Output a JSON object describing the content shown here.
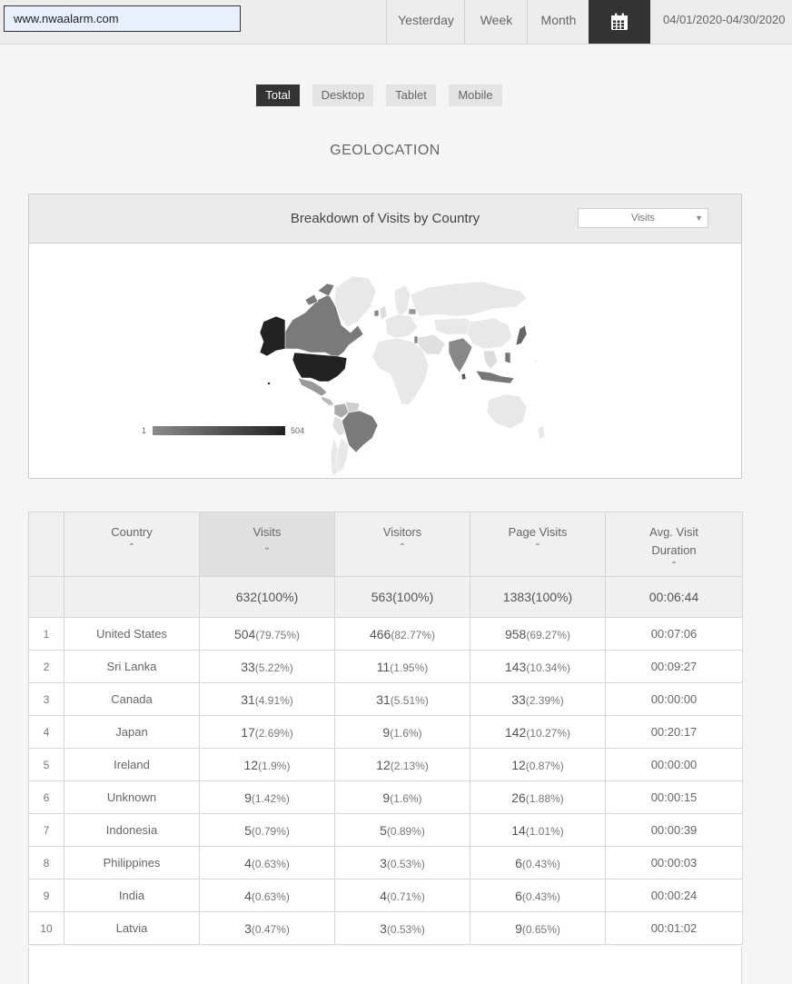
{
  "topbar": {
    "site": "www.nwaalarm.com",
    "periods": [
      "Yesterday",
      "Week",
      "Month"
    ],
    "calendar_icon": "calendar-icon",
    "date_range": "04/01/2020-04/30/2020"
  },
  "device_tabs": [
    "Total",
    "Desktop",
    "Tablet",
    "Mobile"
  ],
  "active_tab": "Total",
  "section_title": "GEOLOCATION",
  "map": {
    "title": "Breakdown of Visits by Country",
    "metric_selected": "Visits",
    "legend_min": "1",
    "legend_max": "504",
    "colors": {
      "low": "#8a8a8a",
      "high": "#222222",
      "none": "#e8e8e8"
    }
  },
  "table": {
    "headers": {
      "country": "Country",
      "visits": "Visits",
      "visitors": "Visitors",
      "page_visits": "Page Visits",
      "avg_duration": "Avg. Visit Duration"
    },
    "sorted_column": "visits",
    "sort_arrows": {
      "up": "⌃",
      "down": "⌄"
    },
    "totals": {
      "visits": "632(100%)",
      "visitors": "563(100%)",
      "page_visits": "1383(100%)",
      "avg_duration": "00:06:44"
    },
    "rows": [
      {
        "rank": "1",
        "country": "United States",
        "visits": "504",
        "visits_pct": "(79.75%)",
        "visitors": "466",
        "visitors_pct": "(82.77%)",
        "page_visits": "958",
        "page_visits_pct": "(69.27%)",
        "duration": "00:07:06"
      },
      {
        "rank": "2",
        "country": "Sri Lanka",
        "visits": "33",
        "visits_pct": "(5.22%)",
        "visitors": "11",
        "visitors_pct": "(1.95%)",
        "page_visits": "143",
        "page_visits_pct": "(10.34%)",
        "duration": "00:09:27"
      },
      {
        "rank": "3",
        "country": "Canada",
        "visits": "31",
        "visits_pct": "(4.91%)",
        "visitors": "31",
        "visitors_pct": "(5.51%)",
        "page_visits": "33",
        "page_visits_pct": "(2.39%)",
        "duration": "00:00:00"
      },
      {
        "rank": "4",
        "country": "Japan",
        "visits": "17",
        "visits_pct": "(2.69%)",
        "visitors": "9",
        "visitors_pct": "(1.6%)",
        "page_visits": "142",
        "page_visits_pct": "(10.27%)",
        "duration": "00:20:17"
      },
      {
        "rank": "5",
        "country": "Ireland",
        "visits": "12",
        "visits_pct": "(1.9%)",
        "visitors": "12",
        "visitors_pct": "(2.13%)",
        "page_visits": "12",
        "page_visits_pct": "(0.87%)",
        "duration": "00:00:00"
      },
      {
        "rank": "6",
        "country": "Unknown",
        "visits": "9",
        "visits_pct": "(1.42%)",
        "visitors": "9",
        "visitors_pct": "(1.6%)",
        "page_visits": "26",
        "page_visits_pct": "(1.88%)",
        "duration": "00:00:15"
      },
      {
        "rank": "7",
        "country": "Indonesia",
        "visits": "5",
        "visits_pct": "(0.79%)",
        "visitors": "5",
        "visitors_pct": "(0.89%)",
        "page_visits": "14",
        "page_visits_pct": "(1.01%)",
        "duration": "00:00:39"
      },
      {
        "rank": "8",
        "country": "Philippines",
        "visits": "4",
        "visits_pct": "(0.63%)",
        "visitors": "3",
        "visitors_pct": "(0.53%)",
        "page_visits": "6",
        "page_visits_pct": "(0.43%)",
        "duration": "00:00:03"
      },
      {
        "rank": "9",
        "country": "India",
        "visits": "4",
        "visits_pct": "(0.63%)",
        "visitors": "4",
        "visitors_pct": "(0.71%)",
        "page_visits": "6",
        "page_visits_pct": "(0.43%)",
        "duration": "00:00:24"
      },
      {
        "rank": "10",
        "country": "Latvia",
        "visits": "3",
        "visits_pct": "(0.47%)",
        "visitors": "3",
        "visitors_pct": "(0.53%)",
        "page_visits": "9",
        "page_visits_pct": "(0.65%)",
        "duration": "00:01:02"
      }
    ]
  }
}
